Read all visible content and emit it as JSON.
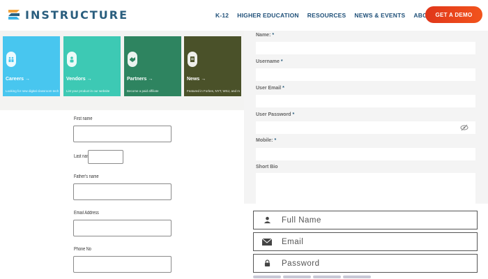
{
  "header": {
    "logo_text": "INSTRUCTURE",
    "nav": [
      "K-12",
      "HIGHER EDUCATION",
      "RESOURCES",
      "NEWS & EVENTS",
      "ABOUT US"
    ],
    "cta_label": "GET A DEMO"
  },
  "cards": [
    {
      "title": "Careers →",
      "desc": "Looking for new digital classroom tech?",
      "color": "#48c6ef"
    },
    {
      "title": "Vendors →",
      "desc": "List your product in our website",
      "color": "#3dc9b4"
    },
    {
      "title": "Partners →",
      "desc": "Become a paid affiliate",
      "color": "#2e8460"
    },
    {
      "title": "News →",
      "desc": "Featured in Forbes, NYT, WSJ, and more",
      "color": "#4a5129"
    }
  ],
  "plain_form": {
    "first_name_label": "First name",
    "last_name_label": "Last name",
    "fathers_name_label": "Father's name",
    "email_label": "Email Address",
    "phone_label": "Phone No"
  },
  "registration_form": {
    "name_label": "Name:",
    "username_label": "Username",
    "email_label": "User Email",
    "password_label": "User Password",
    "mobile_label": "Mobile:",
    "bio_label": "Short Bio",
    "required_mark": "*"
  },
  "icon_form": {
    "full_name_placeholder": "Full Name",
    "email_placeholder": "Email",
    "password_placeholder": "Password"
  },
  "colors": {
    "brand": "#2a5e7e",
    "cta_start": "#e0361a",
    "cta_end": "#f2541c"
  }
}
